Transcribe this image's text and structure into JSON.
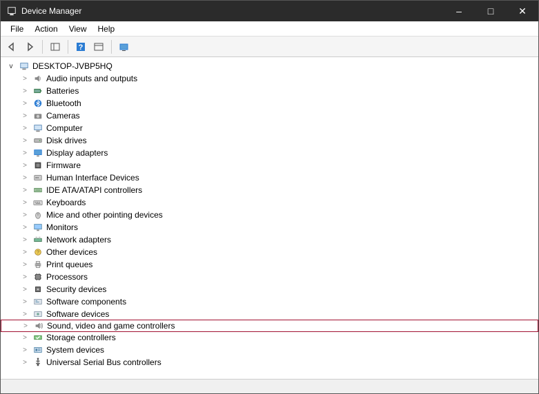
{
  "window": {
    "title": "Device Manager"
  },
  "menubar": {
    "items": [
      "File",
      "Action",
      "View",
      "Help"
    ]
  },
  "tree": {
    "root": {
      "label": "DESKTOP-JVBP5HQ",
      "expanded": true
    },
    "categories": [
      {
        "label": "Audio inputs and outputs",
        "icon": "audio"
      },
      {
        "label": "Batteries",
        "icon": "battery"
      },
      {
        "label": "Bluetooth",
        "icon": "bluetooth"
      },
      {
        "label": "Cameras",
        "icon": "camera"
      },
      {
        "label": "Computer",
        "icon": "computer"
      },
      {
        "label": "Disk drives",
        "icon": "disk"
      },
      {
        "label": "Display adapters",
        "icon": "display"
      },
      {
        "label": "Firmware",
        "icon": "firmware"
      },
      {
        "label": "Human Interface Devices",
        "icon": "hid"
      },
      {
        "label": "IDE ATA/ATAPI controllers",
        "icon": "ide"
      },
      {
        "label": "Keyboards",
        "icon": "keyboard"
      },
      {
        "label": "Mice and other pointing devices",
        "icon": "mouse"
      },
      {
        "label": "Monitors",
        "icon": "monitor"
      },
      {
        "label": "Network adapters",
        "icon": "network"
      },
      {
        "label": "Other devices",
        "icon": "other"
      },
      {
        "label": "Print queues",
        "icon": "printer"
      },
      {
        "label": "Processors",
        "icon": "cpu"
      },
      {
        "label": "Security devices",
        "icon": "security"
      },
      {
        "label": "Software components",
        "icon": "swcomp"
      },
      {
        "label": "Software devices",
        "icon": "swdev"
      },
      {
        "label": "Sound, video and game controllers",
        "icon": "sound",
        "highlighted": true
      },
      {
        "label": "Storage controllers",
        "icon": "storage"
      },
      {
        "label": "System devices",
        "icon": "system"
      },
      {
        "label": "Universal Serial Bus controllers",
        "icon": "usb"
      }
    ]
  }
}
